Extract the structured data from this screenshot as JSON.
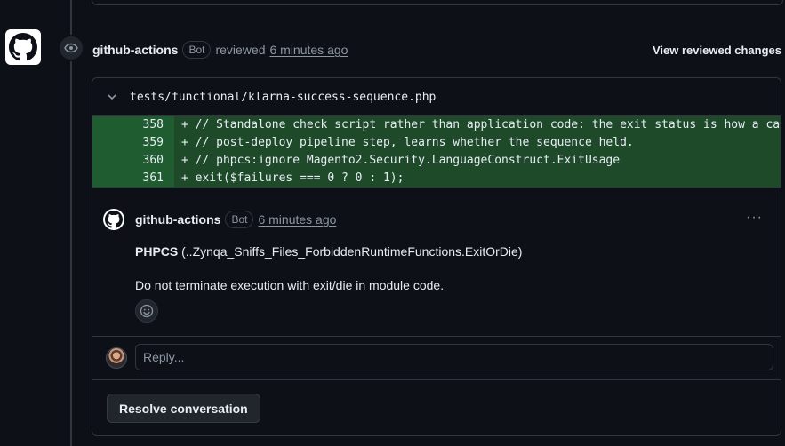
{
  "review": {
    "author": "github-actions",
    "badge": "Bot",
    "action": "reviewed",
    "time": "6 minutes ago",
    "view_changes": "View reviewed changes"
  },
  "file": {
    "path": "tests/functional/klarna-success-sequence.php"
  },
  "diff_lines": [
    {
      "num": "358",
      "code": "+ // Standalone check script rather than application code: the exit status is how a caller, e"
    },
    {
      "num": "359",
      "code": "+ // post-deploy pipeline step, learns whether the sequence held."
    },
    {
      "num": "360",
      "code": "+ // phpcs:ignore Magento2.Security.LanguageConstruct.ExitUsage"
    },
    {
      "num": "361",
      "code": "+ exit($failures === 0 ? 0 : 1);"
    }
  ],
  "comment": {
    "author": "github-actions",
    "badge": "Bot",
    "time": "6 minutes ago",
    "more": "···",
    "title_bold": "PHPCS",
    "title_rest": " (..Zynqa_Sniffs_Files_ForbiddenRuntimeFunctions.ExitOrDie)",
    "body": "Do not terminate execution with exit/die in module code."
  },
  "reply": {
    "placeholder": "Reply..."
  },
  "resolve_label": "Resolve conversation",
  "colors": {
    "background": "#0d1117",
    "border": "#30363d",
    "diff_add": "#1e4a2a",
    "diff_add_num": "#1f5c2f",
    "muted": "#8d96a0"
  },
  "icons": [
    "github-logo-icon",
    "eye-icon",
    "chevron-down-icon",
    "kebab-icon",
    "smiley-icon"
  ]
}
